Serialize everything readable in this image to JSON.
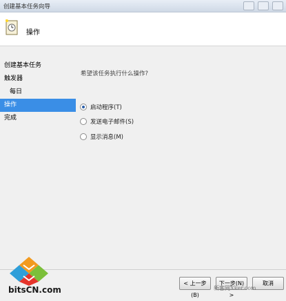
{
  "window": {
    "title": "创建基本任务向导"
  },
  "header": {
    "title": "操作"
  },
  "sidebar": {
    "items": [
      {
        "label": "创建基本任务"
      },
      {
        "label": "触发器"
      },
      {
        "label": "每日"
      },
      {
        "label": "操作"
      },
      {
        "label": "完成"
      }
    ]
  },
  "main": {
    "question": "希望该任务执行什么操作?",
    "options": [
      {
        "label": "启动程序(T)",
        "selected": true
      },
      {
        "label": "发送电子邮件(S)",
        "selected": false
      },
      {
        "label": "显示消息(M)",
        "selected": false
      }
    ]
  },
  "footer": {
    "back_label": "< 上一步(B)",
    "next_label": "下一步(N) >",
    "cancel_label": "取消"
  },
  "overlay": {
    "logo_text": "bitsCN.com",
    "watermark_text": "新客网Xker.com"
  },
  "colors": {
    "selected_bg": "#3a8ee6",
    "radio_dot": "#2a5ea8"
  }
}
